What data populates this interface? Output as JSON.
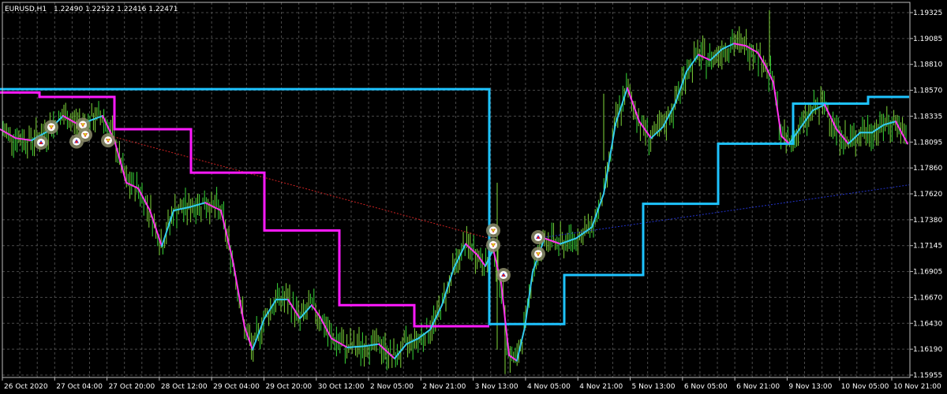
{
  "chart_data": {
    "type": "candlestick",
    "symbol_label": "EURUSD,H1",
    "ohlc_label": "1.22490 1.22522 1.22416 1.22471",
    "ylim": [
      1.1595,
      1.1932
    ],
    "y_ticks": [
      "1.19325",
      "1.19085",
      "1.18810",
      "1.18570",
      "1.18335",
      "1.18095",
      "1.17860",
      "1.17620",
      "1.17380",
      "1.17145",
      "1.16905",
      "1.16670",
      "1.16430",
      "1.16190",
      "1.15955"
    ],
    "x_ticks": [
      "26 Oct 2020",
      "27 Oct 04:00",
      "27 Oct 20:00",
      "28 Oct 12:00",
      "29 Oct 04:00",
      "29 Oct 20:00",
      "30 Oct 12:00",
      "2 Nov 05:00",
      "2 Nov 21:00",
      "3 Nov 13:00",
      "4 Nov 05:00",
      "4 Nov 21:00",
      "5 Nov 13:00",
      "6 Nov 05:00",
      "6 Nov 21:00",
      "9 Nov 13:00",
      "10 Nov 05:00",
      "10 Nov 21:00"
    ],
    "grid": true,
    "colors": {
      "background": "#000000",
      "bars": "#7fd63a",
      "bars_alt": "#38d838",
      "step_magenta": "#ff1aff",
      "step_cyan": "#1ec3ff",
      "smooth_up": "#33ccee",
      "smooth_down": "#ff33ee",
      "trend_red": "#cc2222",
      "trend_blue": "#2233cc",
      "text": "#ffffff",
      "marker_ring": "#8c8c6a"
    },
    "series": [
      {
        "kind": "step",
        "color_key": "step_magenta",
        "x": [
          0,
          50,
          145,
          242,
          335,
          430,
          525,
          620
        ],
        "y": [
          1.1851,
          1.1847,
          1.1818,
          1.1779,
          1.1727,
          1.166,
          1.1641,
          1.1641
        ]
      },
      {
        "kind": "step",
        "color_key": "step_cyan",
        "x": [
          0,
          50,
          620,
          715,
          815,
          910,
          1005,
          1100,
          1152
        ],
        "y": [
          1.1854,
          1.1854,
          1.1643,
          1.1687,
          1.1751,
          1.1805,
          1.1841,
          1.1847,
          1.1847
        ]
      },
      {
        "kind": "smooth",
        "x": [
          0,
          20,
          40,
          60,
          80,
          100,
          115,
          130,
          145,
          160,
          175,
          190,
          205,
          220,
          240,
          260,
          280,
          295,
          310,
          320,
          335,
          350,
          365,
          380,
          395,
          405,
          420,
          440,
          460,
          480,
          500,
          515,
          530,
          545,
          560,
          575,
          590,
          605,
          615,
          625,
          635,
          645,
          655,
          665,
          675,
          690,
          710,
          730,
          750,
          765,
          780,
          795,
          810,
          825,
          840,
          855,
          870,
          885,
          900,
          915,
          930,
          945,
          960,
          970,
          980,
          990,
          1000,
          1015,
          1030,
          1045,
          1060,
          1075,
          1090,
          1105,
          1120,
          1135,
          1150
        ],
        "y": [
          1.1818,
          1.181,
          1.1808,
          1.1816,
          1.183,
          1.1822,
          1.1826,
          1.183,
          1.1808,
          1.177,
          1.1765,
          1.1745,
          1.1713,
          1.1745,
          1.1748,
          1.1752,
          1.1745,
          1.17,
          1.164,
          1.162,
          1.1648,
          1.1665,
          1.1665,
          1.1648,
          1.166,
          1.165,
          1.163,
          1.1622,
          1.1623,
          1.1625,
          1.1612,
          1.1625,
          1.163,
          1.1638,
          1.166,
          1.1693,
          1.1715,
          1.1705,
          1.1695,
          1.171,
          1.168,
          1.1615,
          1.161,
          1.164,
          1.169,
          1.172,
          1.1715,
          1.172,
          1.173,
          1.176,
          1.1823,
          1.1855,
          1.1825,
          1.181,
          1.182,
          1.184,
          1.187,
          1.1885,
          1.188,
          1.189,
          1.1895,
          1.1893,
          1.1887,
          1.1875,
          1.186,
          1.1812,
          1.1805,
          1.182,
          1.1835,
          1.184,
          1.1818,
          1.1805,
          1.1815,
          1.1815,
          1.1822,
          1.1825,
          1.1805
        ]
      },
      {
        "kind": "trendline",
        "color_key": "trend_red",
        "x": [
          140,
          620
        ],
        "y": [
          1.1812,
          1.172
        ]
      },
      {
        "kind": "trendline",
        "color_key": "trend_blue",
        "x": [
          680,
          1152
        ],
        "y": [
          1.172,
          1.1768
        ]
      }
    ],
    "markers": [
      {
        "x": 52,
        "y": 1.1806,
        "arrow": "up"
      },
      {
        "x": 65,
        "y": 1.182,
        "arrow": "down"
      },
      {
        "x": 97,
        "y": 1.1807,
        "arrow": "up"
      },
      {
        "x": 105,
        "y": 1.1822,
        "arrow": "down"
      },
      {
        "x": 108,
        "y": 1.1813,
        "arrow": "down"
      },
      {
        "x": 137,
        "y": 1.1808,
        "arrow": "down"
      },
      {
        "x": 625,
        "y": 1.1727,
        "arrow": "down"
      },
      {
        "x": 625,
        "y": 1.1714,
        "arrow": "down"
      },
      {
        "x": 638,
        "y": 1.1687,
        "arrow": "up"
      },
      {
        "x": 682,
        "y": 1.1721,
        "arrow": "up"
      },
      {
        "x": 682,
        "y": 1.1706,
        "arrow": "down"
      }
    ]
  }
}
